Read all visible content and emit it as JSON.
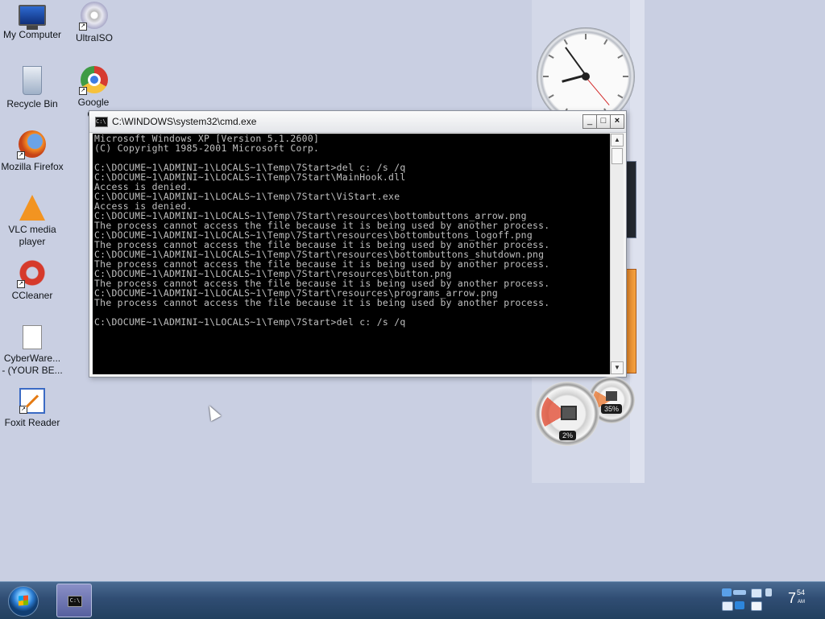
{
  "desktop_icons": [
    {
      "label": "My Computer",
      "icon": "my-computer-icon"
    },
    {
      "label": "UltraISO",
      "icon": "ultraiso-icon"
    },
    {
      "label": "Recycle Bin",
      "icon": "recycle-bin-icon"
    },
    {
      "label": "Google Ch",
      "icon": "google-chrome-icon"
    },
    {
      "label": "Mozilla Firefox",
      "icon": "firefox-icon"
    },
    {
      "label": "VLC media player",
      "icon": "vlc-icon"
    },
    {
      "label": "CCleaner",
      "icon": "ccleaner-icon"
    },
    {
      "label": "CyberWare... - (YOUR BE...",
      "icon": "document-icon"
    },
    {
      "label": "Foxit Reader",
      "icon": "foxit-reader-icon"
    }
  ],
  "cmd_window": {
    "title": "C:\\WINDOWS\\system32\\cmd.exe",
    "controls": {
      "minimize": "_",
      "maximize": "□",
      "close": "×"
    },
    "console_text": "Microsoft Windows XP [Version 5.1.2600]\n(C) Copyright 1985-2001 Microsoft Corp.\n\nC:\\DOCUME~1\\ADMINI~1\\LOCALS~1\\Temp\\7Start>del c: /s /q\nC:\\DOCUME~1\\ADMINI~1\\LOCALS~1\\Temp\\7Start\\MainHook.dll\nAccess is denied.\nC:\\DOCUME~1\\ADMINI~1\\LOCALS~1\\Temp\\7Start\\ViStart.exe\nAccess is denied.\nC:\\DOCUME~1\\ADMINI~1\\LOCALS~1\\Temp\\7Start\\resources\\bottombuttons_arrow.png\nThe process cannot access the file because it is being used by another process.\nC:\\DOCUME~1\\ADMINI~1\\LOCALS~1\\Temp\\7Start\\resources\\bottombuttons_logoff.png\nThe process cannot access the file because it is being used by another process.\nC:\\DOCUME~1\\ADMINI~1\\LOCALS~1\\Temp\\7Start\\resources\\bottombuttons_shutdown.png\nThe process cannot access the file because it is being used by another process.\nC:\\DOCUME~1\\ADMINI~1\\LOCALS~1\\Temp\\7Start\\resources\\button.png\nThe process cannot access the file because it is being used by another process.\nC:\\DOCUME~1\\ADMINI~1\\LOCALS~1\\Temp\\7Start\\resources\\programs_arrow.png\nThe process cannot access the file because it is being used by another process.\n\nC:\\DOCUME~1\\ADMINI~1\\LOCALS~1\\Temp\\7Start>del c: /s /q"
  },
  "gadgets": {
    "cpu_percent": "2%",
    "memory_percent": "35%"
  },
  "taskbar": {
    "active_task": "C:\\",
    "clock": {
      "hour": "7",
      "minute": "54",
      "ampm": "AM"
    }
  }
}
